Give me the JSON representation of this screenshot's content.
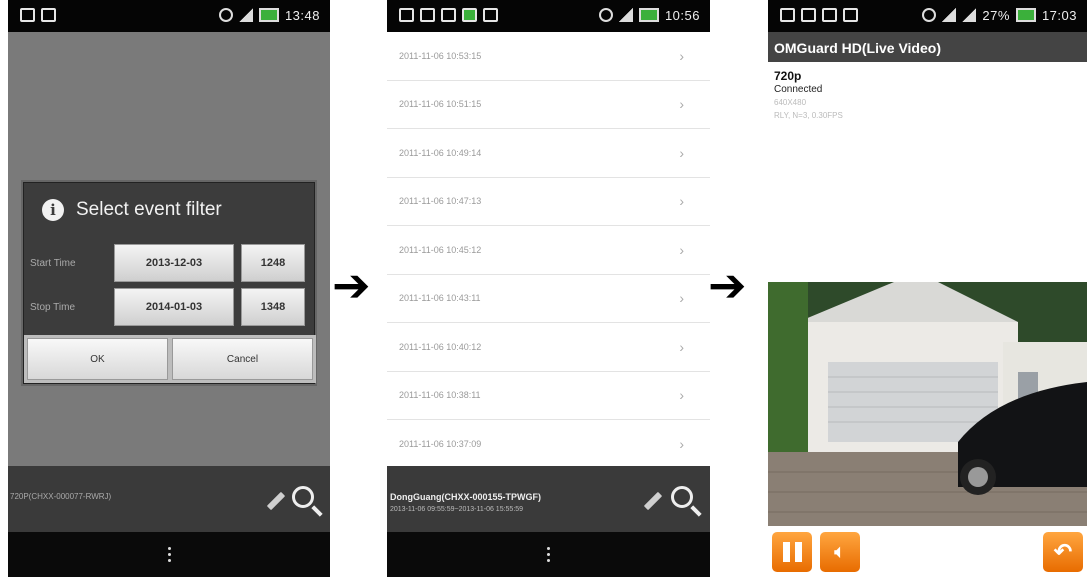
{
  "phone1": {
    "status_time": "13:48",
    "dialog": {
      "title": "Select event filter",
      "start_label": "Start Time",
      "start_date": "2013-12-03",
      "start_time": "1248",
      "stop_label": "Stop Time",
      "stop_date": "2014-01-03",
      "stop_time": "1348",
      "ok_label": "OK",
      "cancel_label": "Cancel"
    },
    "device_text": "720P(CHXX-000077-RWRJ)"
  },
  "phone2": {
    "status_time": "10:56",
    "events": [
      "2011-11-06 10:53:15",
      "2011-11-06 10:51:15",
      "2011-11-06 10:49:14",
      "2011-11-06 10:47:13",
      "2011-11-06 10:45:12",
      "2011-11-06 10:43:11",
      "2011-11-06 10:40:12",
      "2011-11-06 10:38:11",
      "2011-11-06 10:37:09"
    ],
    "device_name": "DongGuang(CHXX-000155-TPWGF)",
    "time_range": "2013-11-06 09:55:59~2013-11-06 15:55:59"
  },
  "phone3": {
    "status_battery": "27%",
    "status_time": "17:03",
    "title": "OMGuard HD(Live Video)",
    "quality": "720p",
    "connection": "Connected",
    "resolution": "640X480",
    "stats": "RLY, N=3, 0.30FPS"
  },
  "colors": {
    "accent_orange": "#f08a1a",
    "battery_green": "#3bb03b"
  }
}
